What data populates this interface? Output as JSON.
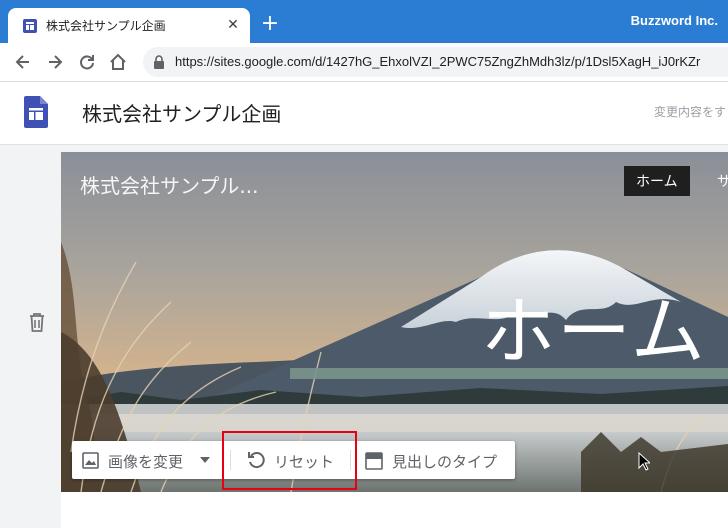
{
  "browser": {
    "tab_title": "株式会社サンプル企画",
    "tab_close": "✕",
    "new_tab": "+",
    "brand": "Buzzword Inc.",
    "url": "https://sites.google.com/d/1427hG_EhxolVZI_2PWC75ZngZhMdh3lz/p/1Dsl5XagH_iJ0rKZr"
  },
  "sites_header": {
    "site_name": "株式会社サンプル企画",
    "save_status": "変更内容をす"
  },
  "banner": {
    "site_title": "株式会社サンプル...",
    "nav_home": "ホーム",
    "nav_next": "サ",
    "hero_title": "ホーム"
  },
  "header_tools": {
    "change_image": "画像を変更",
    "reset": "リセット",
    "header_type": "見出しのタイプ"
  },
  "colors": {
    "tabstrip": "#2b7cd3",
    "highlight": "#e60012",
    "sites_logo": "#3f51b5"
  },
  "icons": [
    "sites-favicon-icon",
    "close-icon",
    "plus-icon",
    "back-arrow-icon",
    "forward-arrow-icon",
    "reload-icon",
    "home-icon",
    "lock-icon",
    "google-sites-logo-icon",
    "trash-icon",
    "image-icon",
    "chevron-down-icon",
    "reset-icon",
    "header-type-icon",
    "mouse-cursor-icon"
  ]
}
